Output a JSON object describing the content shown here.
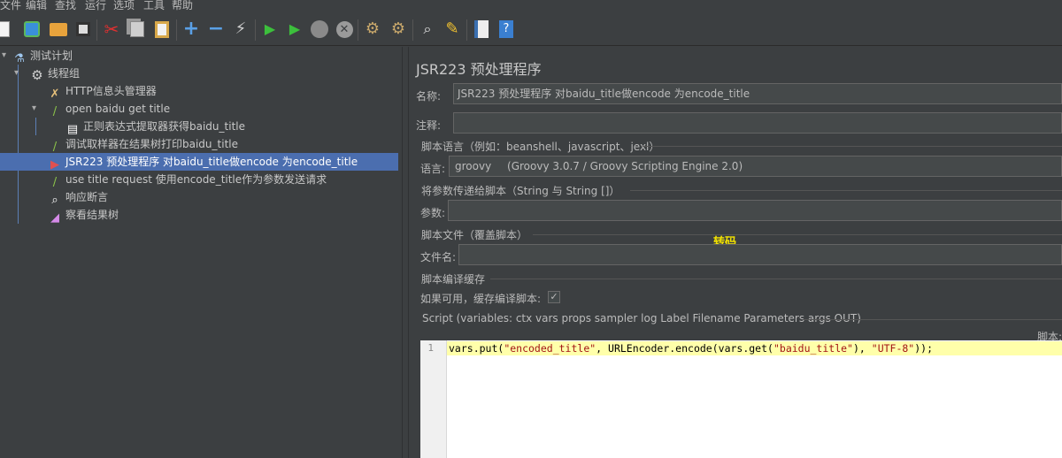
{
  "menu": [
    "文件",
    "编辑",
    "查找",
    "运行",
    "选项",
    "工具",
    "帮助"
  ],
  "toolbar": {
    "icons": [
      "new-icon",
      "templates-icon",
      "open-icon",
      "save-icon",
      "cut-icon",
      "copy-icon",
      "paste-icon",
      "expand-icon",
      "collapse-icon",
      "toggle-icon",
      "start-icon",
      "start-no-pause-icon",
      "stop-icon",
      "shutdown-icon",
      "clear-icon",
      "clear-all-icon",
      "search-icon",
      "reset-search-icon",
      "function-helper-icon",
      "help-icon"
    ]
  },
  "tree": {
    "items": [
      {
        "label": "测试计划",
        "icon": "test-plan-icon"
      },
      {
        "label": "线程组",
        "icon": "thread-group-gear-icon"
      },
      {
        "label": "HTTP信息头管理器",
        "icon": "header-manager-tools-icon"
      },
      {
        "label": "open baidu get title",
        "icon": "sampler-pipette-icon"
      },
      {
        "label": "正则表达式提取器获得baidu_title",
        "icon": "extractor-document-icon"
      },
      {
        "label": "调试取样器在结果树打印baidu_title",
        "icon": "debug-sampler-pipette-icon"
      },
      {
        "label": "JSR223 预处理程序  对baidu_title做encode 为encode_title",
        "icon": "jsr223-preprocessor-icon"
      },
      {
        "label": "use title request  使用encode_title作为参数发送请求",
        "icon": "sampler-pipette-icon"
      },
      {
        "label": "响应断言",
        "icon": "assertion-magnifier-icon"
      },
      {
        "label": "察看结果树",
        "icon": "results-tree-chart-icon"
      }
    ],
    "selected_index": 6
  },
  "panel": {
    "title": "JSR223 预处理程序",
    "name_label": "名称:",
    "name_value": "JSR223 预处理程序  对baidu_title做encode 为encode_title",
    "comment_label": "注释:",
    "comment_value": "",
    "lang_group": "脚本语言（例如：beanshell、javascript、jexl）",
    "lang_label": "语言:",
    "lang_value": "groovy",
    "lang_detail": "(Groovy 3.0.7 / Groovy Scripting Engine 2.0)",
    "params_group": "将参数传递给脚本（String 与 String []）",
    "params_label": "参数:",
    "params_value": "",
    "file_group": "脚本文件（覆盖脚本）",
    "file_label": "文件名:",
    "file_value": "",
    "annotation": "转码",
    "cache_group": "脚本编译缓存",
    "cache_label": "如果可用，缓存编译脚本:",
    "cache_checked": true,
    "script_group": "Script (variables: ctx vars props sampler log Label Filename Parameters args OUT)",
    "script_side_label": "脚本:",
    "line_number": "1",
    "code": "vars.put(\"encoded_title\", URLEncoder.encode(vars.get(\"baidu_title\"), \"UTF-8\"));"
  }
}
